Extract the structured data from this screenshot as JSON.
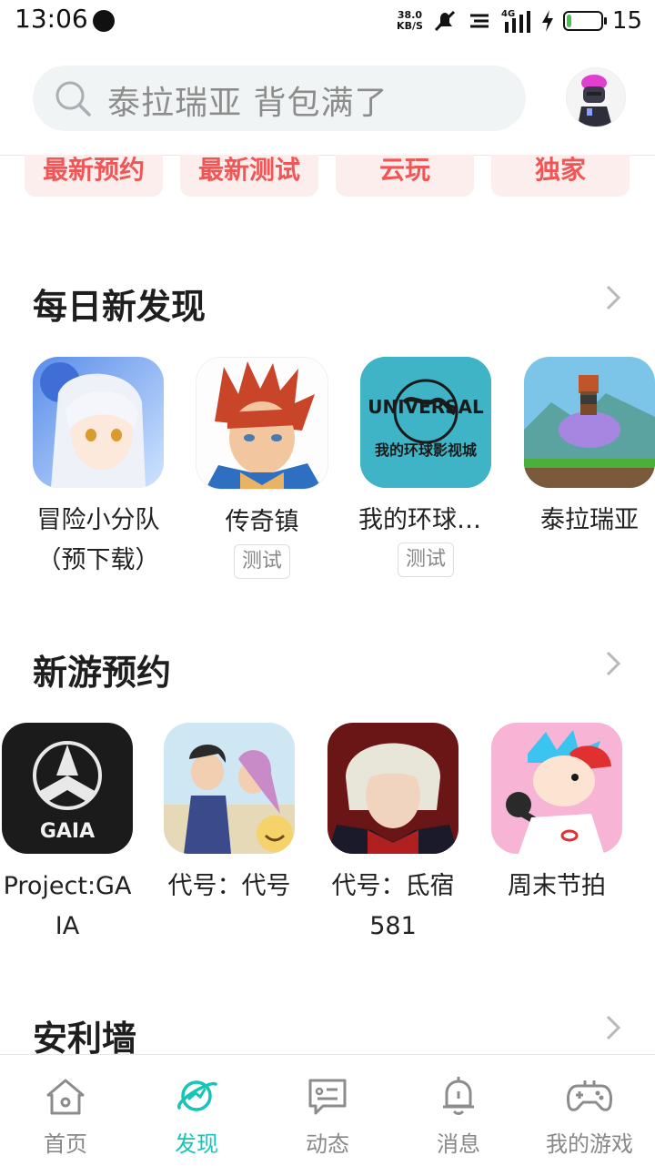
{
  "status_bar": {
    "time": "13:06",
    "net_speed_value": "38.0",
    "net_speed_unit": "KB/S",
    "network": "4G",
    "battery_level": "15"
  },
  "search": {
    "placeholder": "泰拉瑞亚 背包满了"
  },
  "chips": [
    "最新预约",
    "最新测试",
    "云玩",
    "独家"
  ],
  "daily": {
    "title": "每日新发现",
    "games": [
      {
        "name": "冒险小分队（预下载）",
        "tag": ""
      },
      {
        "name": "传奇镇",
        "tag": "测试"
      },
      {
        "name": "我的环球影视城",
        "tag": "测试",
        "icon_text_top": "UNIVERSAL",
        "icon_text_bottom": "我的环球影视城"
      },
      {
        "name": "泰拉瑞亚",
        "tag": ""
      }
    ]
  },
  "preorder": {
    "title": "新游预约",
    "games": [
      {
        "name": "Project:GAIA",
        "icon_text": "GAIA"
      },
      {
        "name": "代号：代号"
      },
      {
        "name": "代号：氐宿581"
      },
      {
        "name": "周末节拍"
      }
    ]
  },
  "third_section": {
    "title": "安利墙"
  },
  "nav": [
    {
      "label": "首页",
      "icon": "home-icon"
    },
    {
      "label": "发现",
      "icon": "planet-icon",
      "active": true
    },
    {
      "label": "动态",
      "icon": "chat-bubble-icon"
    },
    {
      "label": "消息",
      "icon": "bell-icon"
    },
    {
      "label": "我的游戏",
      "icon": "gamepad-icon"
    }
  ],
  "colors": {
    "accent": "#15c5b8",
    "chip_text": "#f05656",
    "chip_bg": "#fdeeee"
  }
}
